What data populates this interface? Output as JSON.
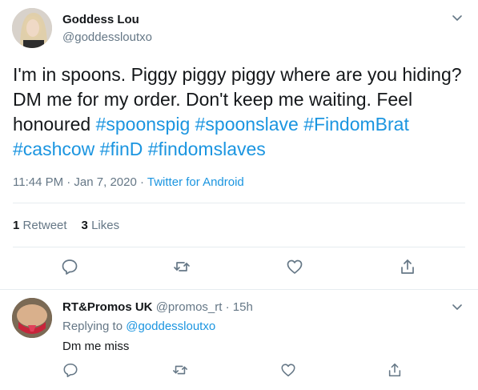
{
  "tweet": {
    "name": "Goddess Lou",
    "handle": "@goddessloutxo",
    "text_part1": "I'm in spoons. Piggy piggy piggy where are you hiding? DM me for my order. Don't keep me waiting. Feel honoured ",
    "tags": [
      "#spoonspig",
      "#spoonslave",
      "#FindomBrat",
      "#cashcow",
      "#finD",
      "#findomslaves"
    ],
    "timestamp": "11:44 PM · Jan 7, 2020 · ",
    "source": "Twitter for Android",
    "retweets_count": "1",
    "retweets_label": "Retweet",
    "likes_count": "3",
    "likes_label": "Likes"
  },
  "reply": {
    "name": "RT&Promos UK",
    "handle": "@promos_rt · 15h",
    "replying_label": "Replying to ",
    "replying_to": "@goddessloutxo",
    "text": "Dm me miss"
  },
  "icons": [
    "reply-icon",
    "retweet-icon",
    "like-icon",
    "share-icon",
    "chevron-down-icon"
  ],
  "colors": {
    "link": "#1b95e0",
    "secondary": "#657786",
    "text": "#14171a",
    "border": "#e6ecf0"
  }
}
